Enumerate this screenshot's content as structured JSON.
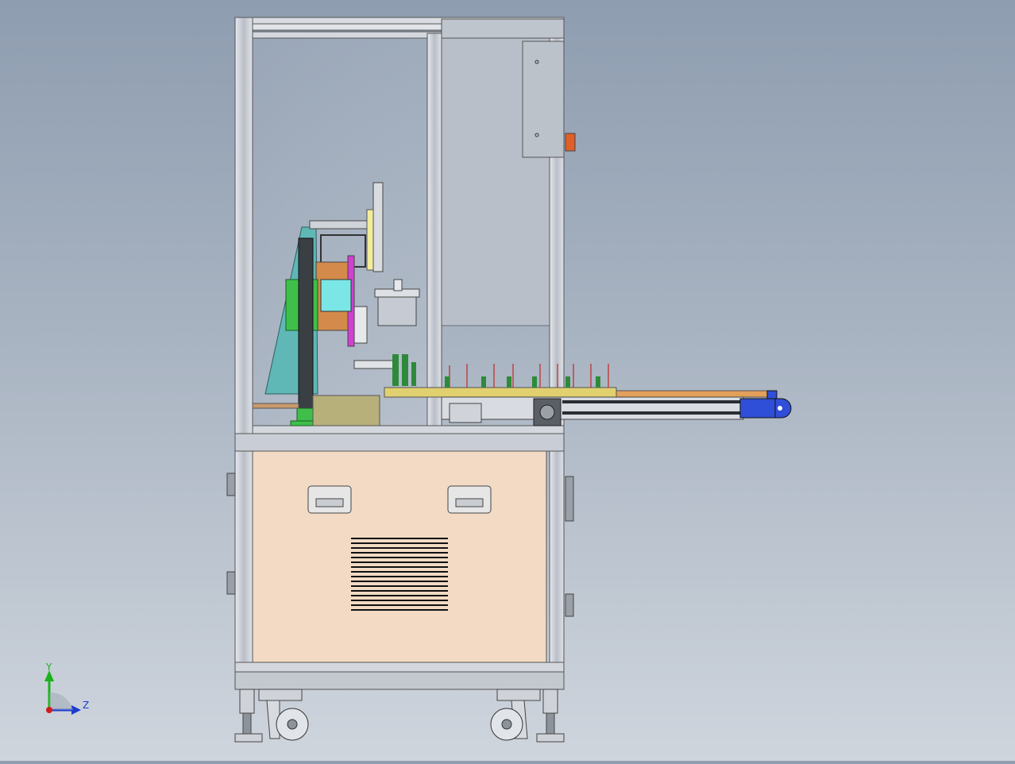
{
  "viewport": {
    "background_top": "#8e9db0",
    "background_bottom": "#cfd5dd"
  },
  "colors": {
    "frame": "#c7ccd4",
    "frame_edge": "#5a5f66",
    "cabinet_panel": "#f2dac4",
    "bracket_cyan": "#5fb7b6",
    "block_green": "#3fbf4a",
    "block_orange": "#d48a4a",
    "block_magenta": "#d23fd2",
    "block_cyan": "#7be6e6",
    "conveyor_belt": "#e2a05a",
    "conveyor_tray": "#e0d070",
    "drive_end_blue": "#2f4fd8",
    "emergency_button": "#e0602a"
  },
  "triad": {
    "y_label": "Y",
    "z_label": "Z",
    "y_color": "#1bb21b",
    "z_color": "#1c3ccf",
    "origin_color": "#d11c1c"
  }
}
